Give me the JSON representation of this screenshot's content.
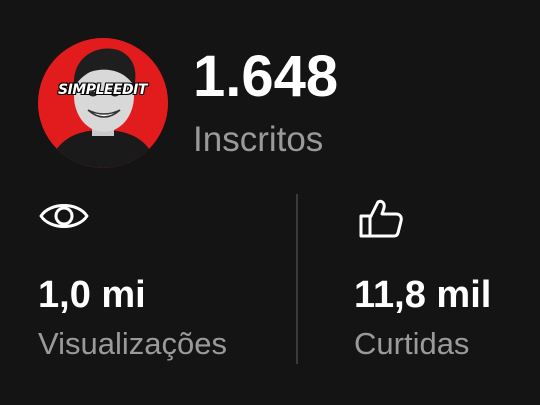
{
  "channel": {
    "avatar_text": "SIMPLEEDIT",
    "subscriber_count": "1.648",
    "subscriber_label": "Inscritos"
  },
  "stats": {
    "views": {
      "icon": "eye-icon",
      "value": "1,0 mi",
      "label": "Visualizações"
    },
    "likes": {
      "icon": "thumbs-up-icon",
      "value": "11,8 mil",
      "label": "Curtidas"
    }
  },
  "colors": {
    "background": "#141414",
    "avatar_bg": "#e21c1c",
    "primary_text": "#ffffff",
    "secondary_text": "#9a9a9a",
    "divider": "#3a3a3a"
  }
}
